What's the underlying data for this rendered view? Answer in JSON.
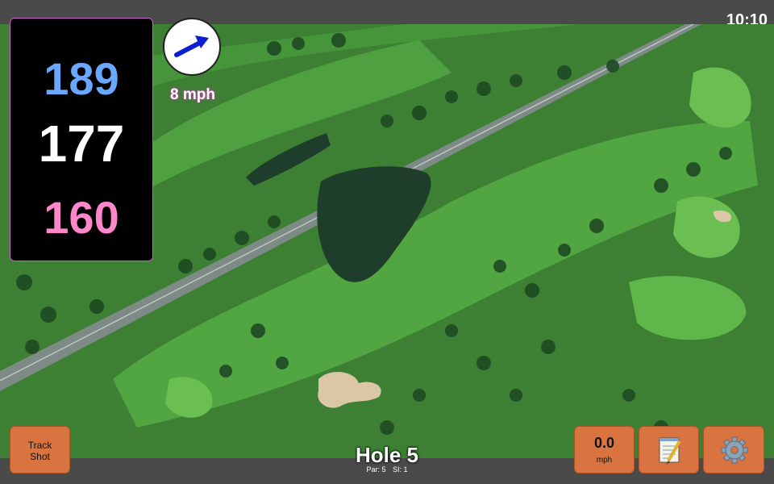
{
  "status_bar": {
    "time": "10:10"
  },
  "distances": {
    "back": "189",
    "middle": "177",
    "front": "160"
  },
  "wind": {
    "speed_label": "8 mph",
    "direction_icon": "arrow-icon"
  },
  "hole": {
    "title": "Hole 5",
    "par_label": "Par: 5",
    "si_label": "SI: 1"
  },
  "buttons": {
    "track_shot_line1": "Track",
    "track_shot_line2": "Shot",
    "speed_value": "0.0",
    "speed_unit": "mph",
    "notes_icon": "notepad-icon",
    "settings_icon": "gear-icon"
  },
  "colors": {
    "back_distance": "#6aa8ff",
    "middle_distance": "#ffffff",
    "front_distance": "#ff86c8",
    "button": "#d9733f",
    "bar": "#4a4a4a"
  }
}
